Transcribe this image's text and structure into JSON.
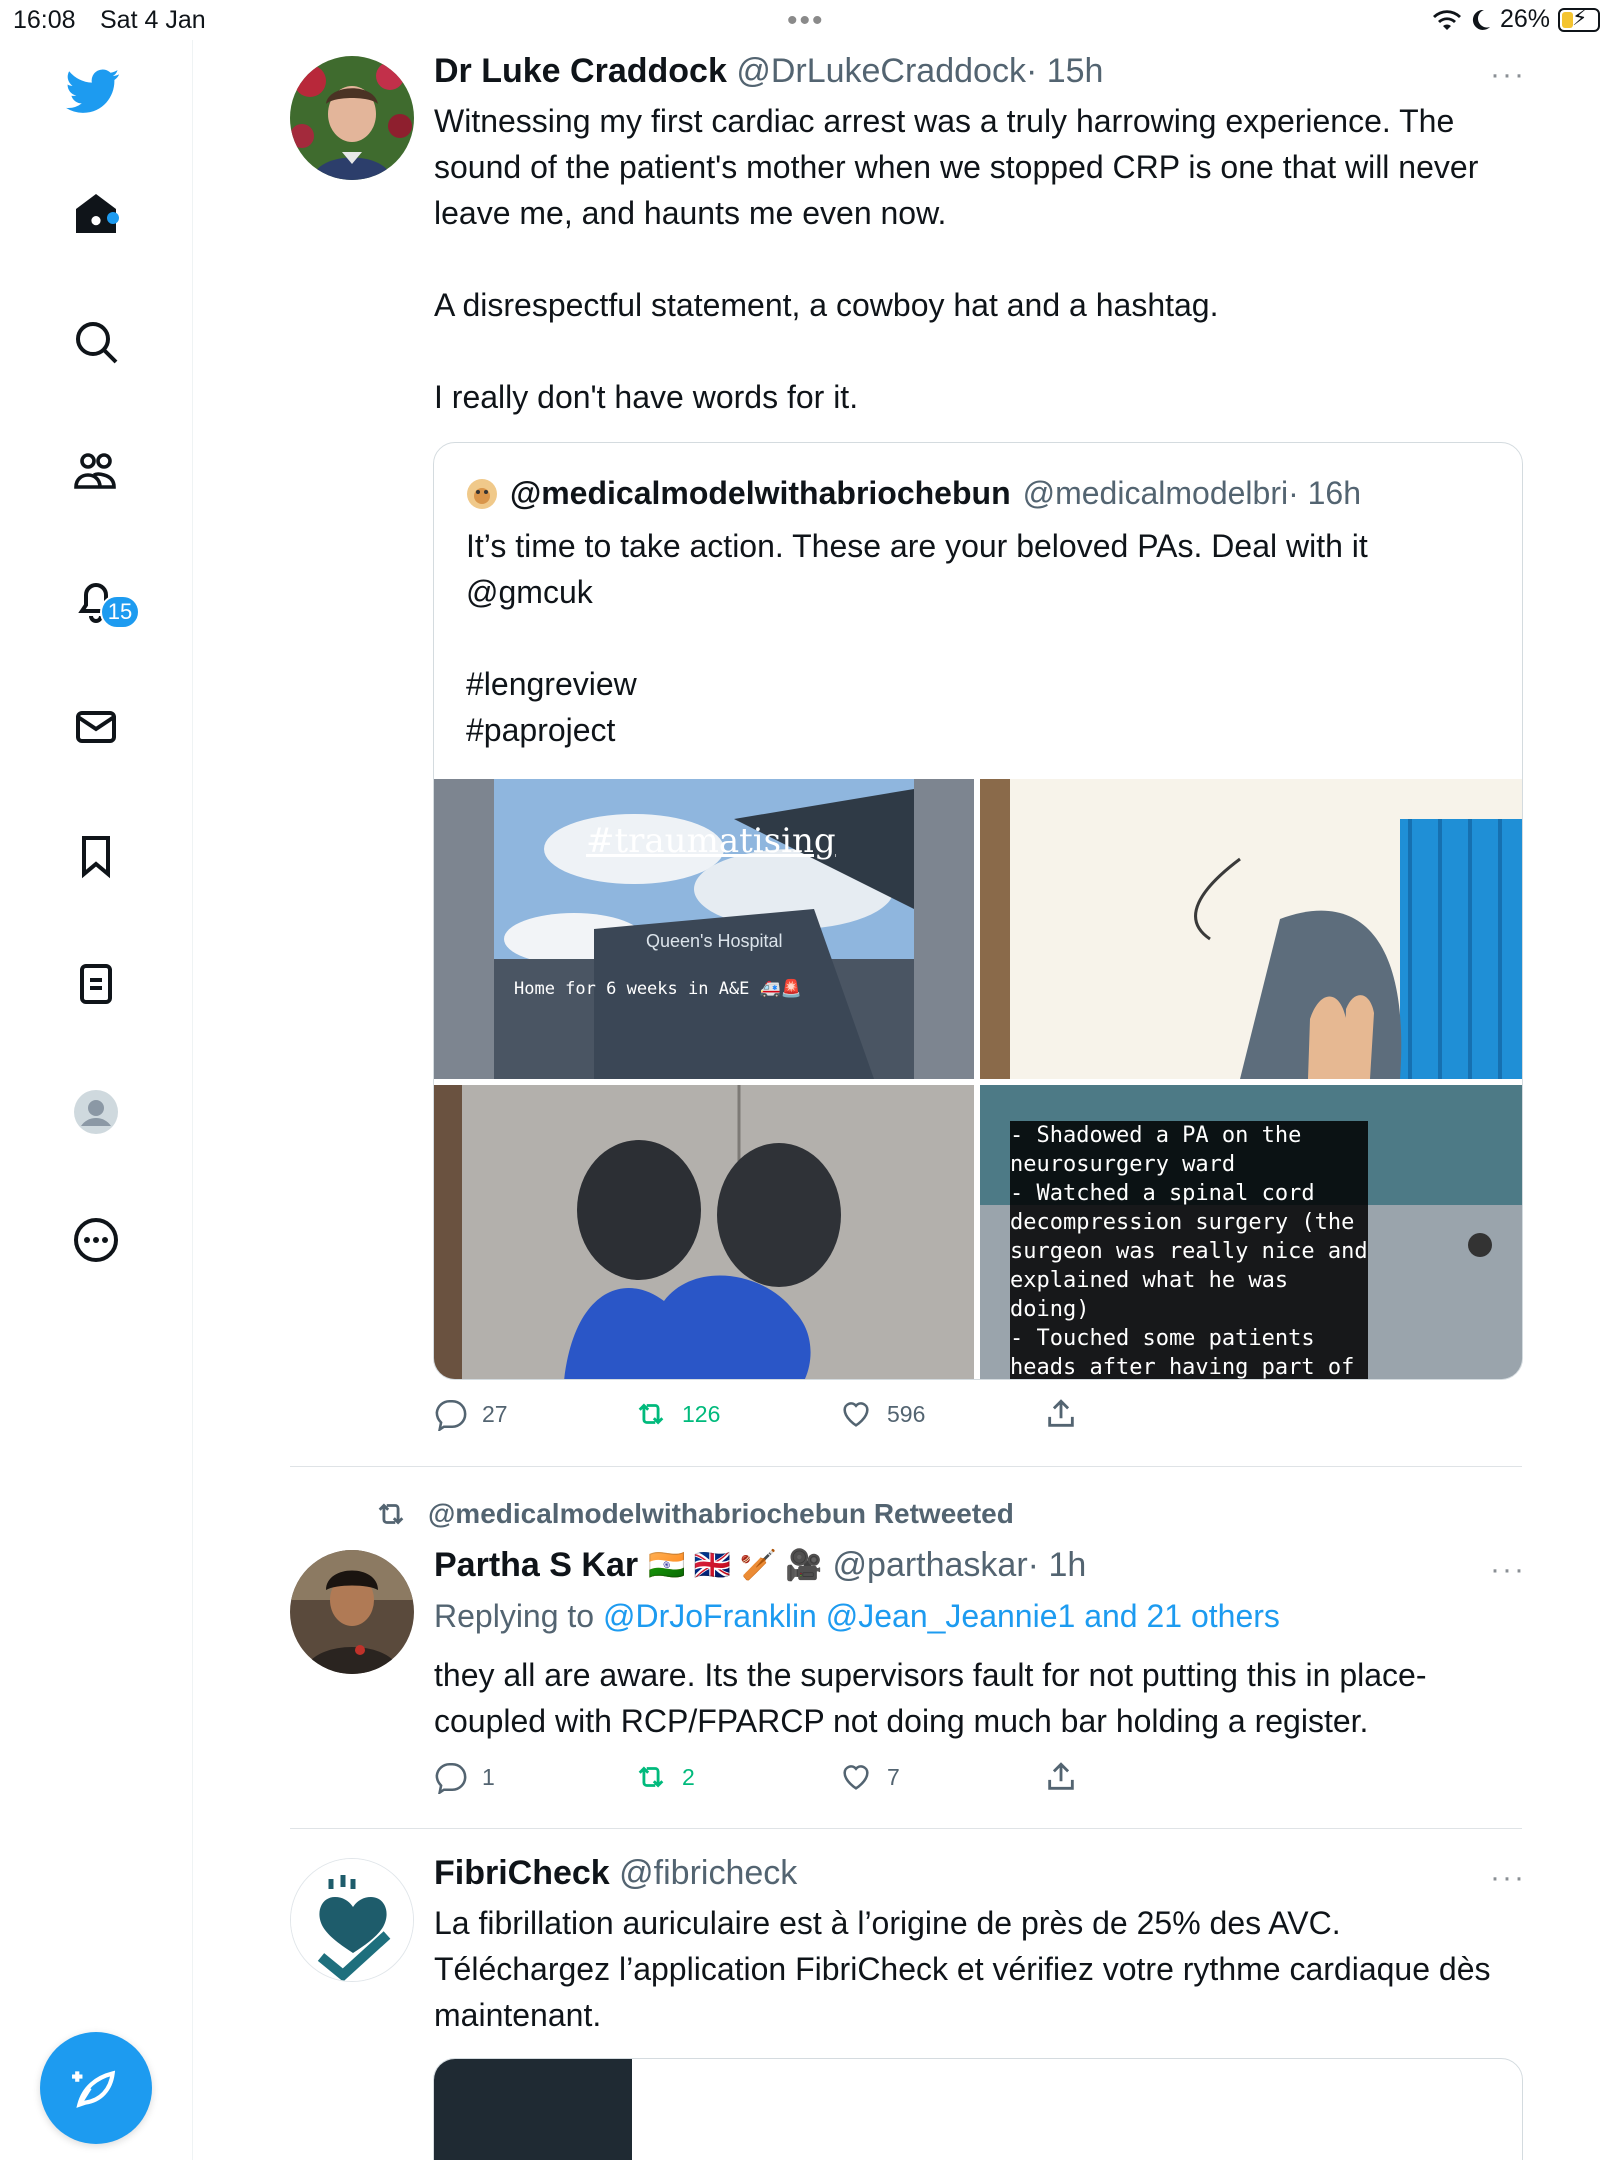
{
  "status_bar": {
    "time": "16:08",
    "date": "Sat 4 Jan",
    "multitask": "•••",
    "battery": "26%"
  },
  "sidebar": {
    "notifications_badge": "15"
  },
  "tweet1": {
    "name": "Dr Luke Craddock",
    "handle": "@DrLukeCraddock",
    "time": "· 15h",
    "text": "Witnessing my first cardiac arrest was a truly harrowing experience. The sound of the patient's mother when we stopped CRP is one that will never leave me, and haunts me even now.\n\nA disrespectful statement, a cowboy hat and a hashtag.\n\nI really don't have words for it.",
    "quote": {
      "name": "@medicalmodelwithabriochebun",
      "handle": "@medicalmodelbri",
      "time": "· 16h",
      "text": "It’s time to take action. These are your beloved PAs. Deal with it @gmcuk\n\n#lengreview\n#paproject",
      "media": [
        {
          "caption_big": "#traumatising",
          "sign": "Queen's Hospital",
          "caption_small": "Home for 6 weeks in A&E 🚑🚨"
        },
        {
          "caption": ""
        },
        {
          "caption": ""
        },
        {
          "caption": "- Shadowed a PA on the\nneurosurgery ward\n- Watched a spinal cord\ndecompression surgery (the\nsurgeon was really nice and\nexplained what he was\ndoing)\n- Touched some patients\nheads after having part of"
        }
      ]
    },
    "replies": "27",
    "retweets": "126",
    "likes": "596"
  },
  "tweet2": {
    "retweeted_by": "@medicalmodelwithabriochebun Retweeted",
    "name": "Partha S Kar",
    "flags": "🇮🇳 🇬🇧 🏏 🎥",
    "handle": "@parthaskar",
    "time": "· 1h",
    "replying_prefix": "Replying to",
    "replying_to": "@DrJoFranklin @Jean_Jeannie1 and 21 others",
    "text": "they all are aware. Its the supervisors fault for not putting this in place- coupled with RCP/FPARCP not doing much bar holding a register.",
    "replies": "1",
    "retweets": "2",
    "likes": "7"
  },
  "tweet3": {
    "name": "FibriCheck",
    "handle": "@fibricheck",
    "text": "La fibrillation auriculaire est à l’origine de près de 25% des AVC.\nTéléchargez l’application FibriCheck et vérifiez votre rythme cardiaque dès maintenant."
  },
  "colors": {
    "accent": "#1d9bf0",
    "retweet_green": "#00ba7c",
    "text": "#0f1419",
    "muted": "#536471"
  }
}
